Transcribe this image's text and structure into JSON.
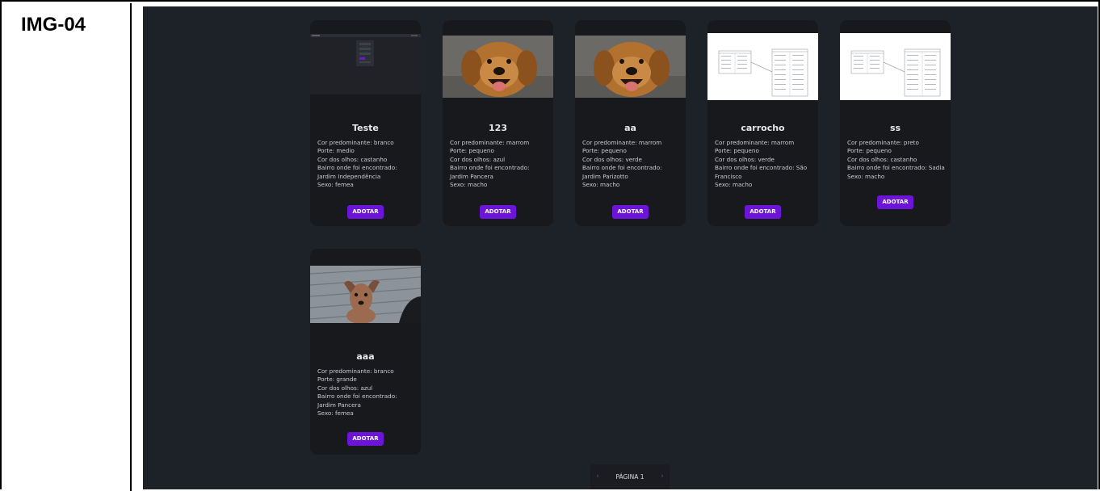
{
  "doc_label": "IMG-04",
  "adopt_label": "ADOTAR",
  "pagination": {
    "label": "PÁGINA 1",
    "prev": "‹",
    "next": "›"
  },
  "cards": [
    {
      "name": "Teste",
      "attrs": [
        "Cor predominante: branco",
        "Porte: medio",
        "Cor dos olhos: castanho",
        "Bairro onde foi encontrado:",
        "Jardim Independência",
        "Sexo: femea"
      ]
    },
    {
      "name": "123",
      "attrs": [
        "Cor predominante: marrom",
        "Porte: pequeno",
        "Cor dos olhos: azul",
        "Bairro onde foi encontrado:",
        "Jardim Pancera",
        "Sexo: macho"
      ]
    },
    {
      "name": "aa",
      "attrs": [
        "Cor predominante: marrom",
        "Porte: pequeno",
        "Cor dos olhos: verde",
        "Bairro onde foi encontrado:",
        "Jardim Parizotto",
        "Sexo: macho"
      ]
    },
    {
      "name": "carrocho",
      "attrs": [
        "Cor predominante: marrom",
        "Porte: pequeno",
        "Cor dos olhos: verde",
        "Bairro onde foi encontrado: São",
        "Francisco",
        "Sexo: macho"
      ]
    },
    {
      "name": "ss",
      "attrs": [
        "Cor predominante: preto",
        "Porte: pequeno",
        "Cor dos olhos: castanho",
        "Bairro onde foi encontrado: Sadia",
        "Sexo: macho"
      ]
    },
    {
      "name": "aaa",
      "attrs": [
        "Cor predominante: branco",
        "Porte: grande",
        "Cor dos olhos: azul",
        "Bairro onde foi encontrado:",
        "Jardim Pancera",
        "Sexo: femea"
      ]
    }
  ]
}
